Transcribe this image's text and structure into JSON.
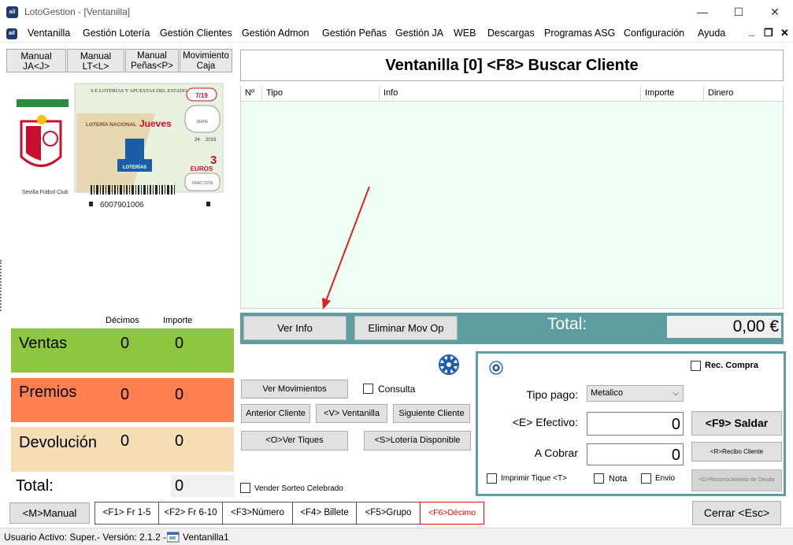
{
  "window": {
    "title": "LotoGestion - [Ventanilla]",
    "app_icon_text": "ail",
    "minimize": "—",
    "maximize": "☐",
    "close": "✕"
  },
  "menu": {
    "items": [
      "Ventanilla",
      "Gestión Lotería",
      "Gestión Clientes",
      "Gestión Admon",
      "Gestión Peñas",
      "Gestión JA",
      "WEB",
      "Descargas",
      "Programas ASG",
      "Configuración",
      "Ayuda"
    ],
    "mdi_minimize": "_",
    "mdi_restore": "❐",
    "mdi_close": "✕"
  },
  "left": {
    "buttons": [
      {
        "line1": "Manual",
        "line2": "JA<J>"
      },
      {
        "line1": "Manual",
        "line2": "LT<L>"
      },
      {
        "line1": "Manual",
        "line2": "Peñas<P>"
      },
      {
        "line1": "Movimiento",
        "line2": "Caja"
      }
    ],
    "ticket": {
      "issuer": "S.E.LOTERÍAS Y APUESTAS DEL ESTADO",
      "draw": "7/19",
      "product": "LOTERÍA NACIONAL",
      "day": "Jueves",
      "serie_label": "SERIE",
      "price": "3",
      "currency": "EUROS",
      "fraction_label": "FRACCIÓN",
      "number": "6007901006",
      "club": "Sevilla Fútbol Club",
      "brand": "LOTERÍAS",
      "date_day": "24",
      "date_year": "2019"
    },
    "stats_headers": {
      "decimos": "Décimos",
      "importe": "Importe"
    },
    "stats": [
      {
        "label": "Ventas",
        "decimos": "0",
        "importe": "0",
        "color": "#8fc63f"
      },
      {
        "label": "Premios",
        "decimos": "0",
        "importe": "0",
        "color": "#ff7f50"
      },
      {
        "label": "Devolución",
        "decimos": "0",
        "importe": "0",
        "color": "#f5deb3"
      }
    ],
    "total_label": "Total:",
    "total_value": "0"
  },
  "main": {
    "header": "Ventanilla [0] <F8> Buscar Cliente",
    "columns": [
      "Nº",
      "Tipo",
      "Info",
      "Importe",
      "Dinero"
    ],
    "ver_info": "Ver Info",
    "eliminar": "Eliminar Mov Op",
    "total_label": "Total:",
    "total_value": "0,00 €",
    "ver_movimientos": "Ver Movimientos",
    "consulta": "Consulta",
    "anterior": "Anterior Cliente",
    "ventanilla_btn": "<V> Ventanilla",
    "siguiente": "Siguiente Cliente",
    "ver_tiques": "<O>Ver Tiques",
    "loteria_disp": "<S>Lotería Disponible",
    "vender_sorteo": "Vender Sorteo Celebrado"
  },
  "payment": {
    "rec_compra": "Rec. Compra",
    "tipo_pago_label": "Tipo pago:",
    "tipo_pago_value": "Metalico",
    "efectivo_label": "<E> Efectivo:",
    "efectivo_value": "0",
    "saldar": "<F9> Saldar",
    "cobrar_label": "A Cobrar",
    "cobrar_value": "0",
    "recibo": "<R>Recibo Cliente",
    "imprimir": "Imprimir Tique <T>",
    "nota": "Nota",
    "envio": "Envio",
    "reconocimiento": "<D>Reconocimiento de Deuda"
  },
  "bottom": {
    "manual": "<M>Manual",
    "fkeys": [
      "<F1> Fr 1-5",
      "<F2> Fr 6-10",
      "<F3>Número",
      "<F4> Billete",
      "<F5>Grupo",
      "<F6>Décimo"
    ],
    "cerrar": "Cerrar <Esc>"
  },
  "status": {
    "user": "Usuario Activo: Super.- Versión: 2.1.2 -",
    "window": "Ventanilla1"
  },
  "colors": {
    "teal": "#5f9ea0",
    "grid_bg": "#f0fff3",
    "decimo_red": "#ff0000"
  }
}
